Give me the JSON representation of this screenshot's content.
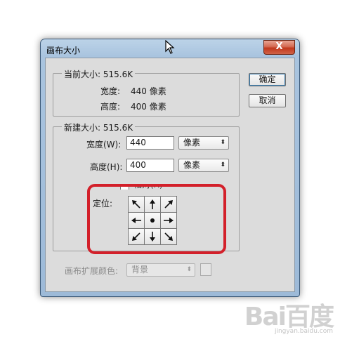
{
  "window": {
    "title": "画布大小",
    "close_glyph": "X"
  },
  "current_size": {
    "heading": "当前大小: 515.6K",
    "width_label": "宽度:",
    "width_value": "440 像素",
    "height_label": "高度:",
    "height_value": "400 像素"
  },
  "new_size": {
    "heading": "新建大小: 515.6K",
    "width_label": "宽度(W):",
    "width_value": "440",
    "width_unit": "像素",
    "height_label": "高度(H):",
    "height_value": "400",
    "height_unit": "像素",
    "relative_label": "相对(R)",
    "anchor_label": "定位:"
  },
  "buttons": {
    "ok": "确定",
    "cancel": "取消"
  },
  "canvas_extension": {
    "label": "画布扩展颜色:",
    "value": "背景"
  },
  "anchor_grid": {
    "cells": [
      "arrow-up-left",
      "arrow-up",
      "arrow-up-right",
      "arrow-left",
      "center-dot",
      "arrow-right",
      "arrow-down-left",
      "arrow-down",
      "arrow-down-right"
    ]
  },
  "watermark": {
    "text": "Bai百度",
    "sub": "jingyan.baidu.com"
  },
  "colors": {
    "highlight": "#d3202a",
    "close_button": "#c0381d",
    "dialog_background": "#dcdcdc"
  }
}
